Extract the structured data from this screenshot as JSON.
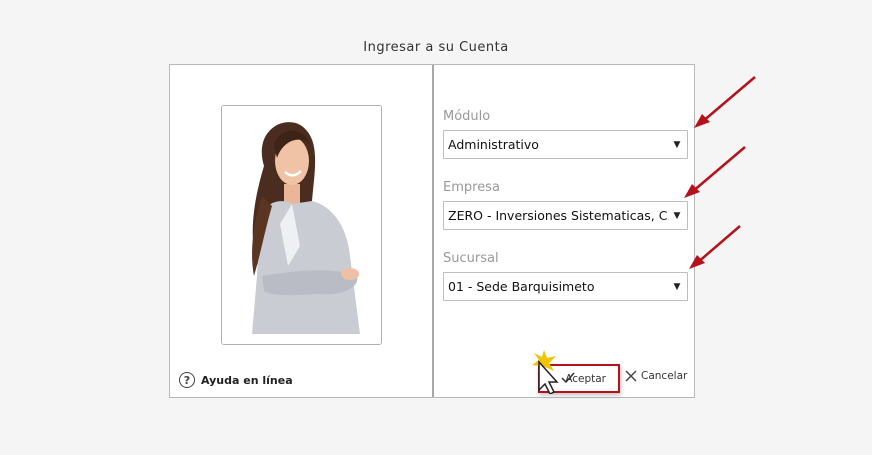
{
  "dialog": {
    "title": "Ingresar a su Cuenta",
    "help_label": "Ayuda en línea",
    "help_icon": "?"
  },
  "form": {
    "modulo": {
      "label": "Módulo",
      "value": "Administrativo"
    },
    "empresa": {
      "label": "Empresa",
      "value": "ZERO - Inversiones Sistematicas, C.A."
    },
    "sucursal": {
      "label": "Sucursal",
      "value": "01 - Sede Barquisimeto"
    }
  },
  "actions": {
    "accept_label": "Aceptar",
    "cancel_label": "Cancelar"
  },
  "icons": {
    "select_arrow": "▼",
    "help": "question-circle-icon",
    "accept": "check-icon",
    "cancel": "close-icon"
  },
  "colors": {
    "annotation_red": "#b5121b",
    "label_gray": "#999999"
  }
}
